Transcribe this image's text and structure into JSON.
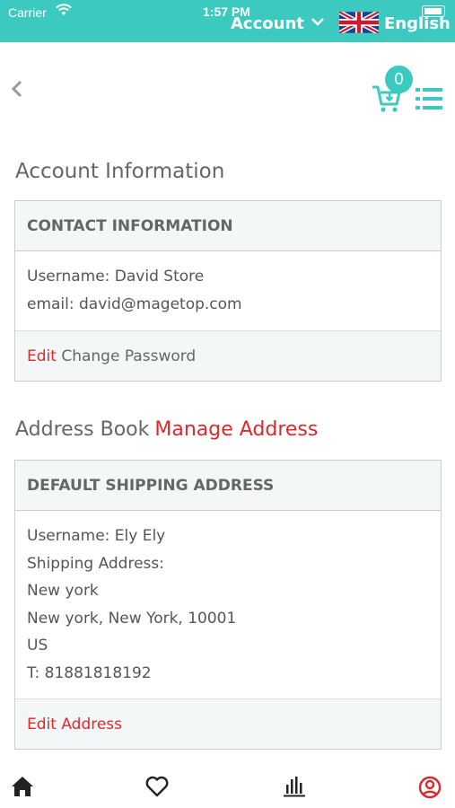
{
  "status_bar": {
    "carrier": "Carrier",
    "time": "1:57 PM"
  },
  "header": {
    "account_label": "Account",
    "language_label": "English"
  },
  "cart": {
    "count": "0"
  },
  "account_section": {
    "title": "Account Information",
    "panel_title": "CONTACT INFORMATION",
    "username_line": "Username:  David Store",
    "email_line": "email: david@magetop.com",
    "edit_label": "Edit",
    "change_password_label": "Change Password"
  },
  "address_section": {
    "title": "Address Book",
    "manage_label": "Manage  Address",
    "panel_title": "DEFAULT SHIPPING ADDRESS",
    "lines": [
      "Username: Ely Ely",
      "Shipping Address:",
      "New york",
      "New york, New York, 10001",
      "US",
      "T:  81881818192"
    ],
    "edit_address_label": "Edit Address"
  },
  "icons": {
    "home": "home-icon",
    "wishlist": "heart-icon",
    "stats": "bar-chart-icon",
    "profile": "user-circle-icon",
    "cart": "cart-icon",
    "menu": "list-icon",
    "back": "chevron-left-icon"
  },
  "colors": {
    "teal": "#3cc9c0",
    "accent_red": "#e2272b",
    "panel_bg": "#f3f7f7"
  }
}
